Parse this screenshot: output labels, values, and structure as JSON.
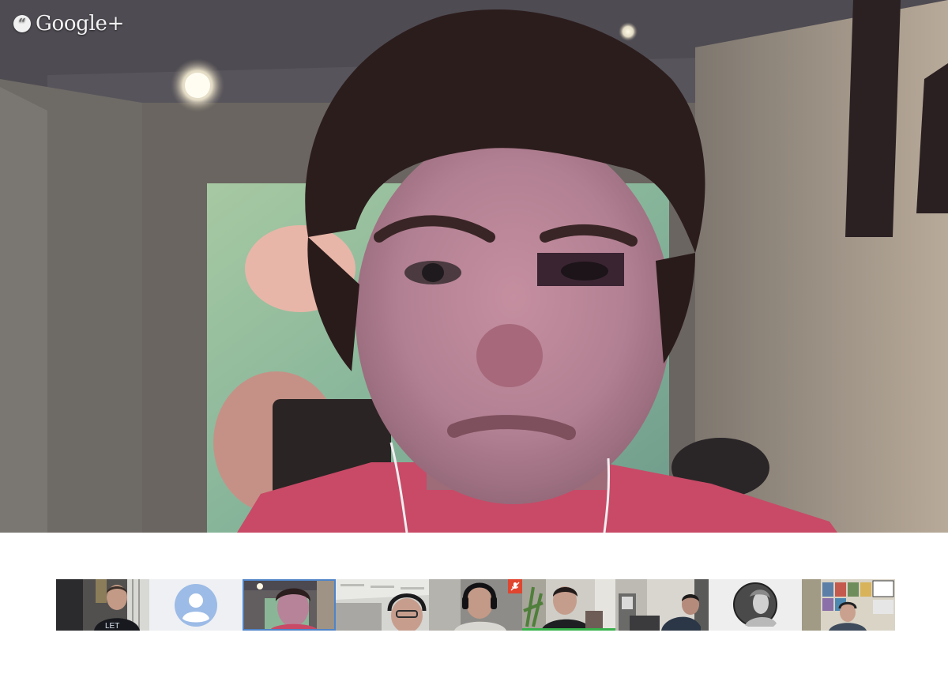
{
  "app": {
    "brand_name": "Google+",
    "brand_icon": "hangouts-quote-icon"
  },
  "main_video": {
    "description_tag": "active-speaker-feed"
  },
  "filmstrip": {
    "participants": [
      {
        "kind": "video",
        "avatar_style": "dark-shirt-man",
        "selected": false,
        "muted": false,
        "speaking": false
      },
      {
        "kind": "placeholder",
        "avatar_style": "default-avatar",
        "selected": false,
        "muted": false,
        "speaking": false
      },
      {
        "kind": "video",
        "avatar_style": "red-shirt-man",
        "selected": true,
        "muted": false,
        "speaking": false
      },
      {
        "kind": "video",
        "avatar_style": "glasses-headset-man",
        "selected": false,
        "muted": false,
        "speaking": false
      },
      {
        "kind": "video",
        "avatar_style": "headset-man",
        "selected": false,
        "muted": true,
        "speaking": false
      },
      {
        "kind": "video",
        "avatar_style": "plant-room-man",
        "selected": false,
        "muted": false,
        "speaking": true
      },
      {
        "kind": "video",
        "avatar_style": "office-man",
        "selected": false,
        "muted": false,
        "speaking": false
      },
      {
        "kind": "photo",
        "avatar_style": "profile-photo",
        "selected": false,
        "muted": false,
        "speaking": false
      },
      {
        "kind": "video",
        "avatar_style": "poster-wall-man",
        "selected": false,
        "muted": false,
        "speaking": false
      }
    ]
  },
  "colors": {
    "selected_outline": "#4f84c8",
    "speaking_bar": "#38b24a",
    "mute_badge": "#e0452f"
  }
}
